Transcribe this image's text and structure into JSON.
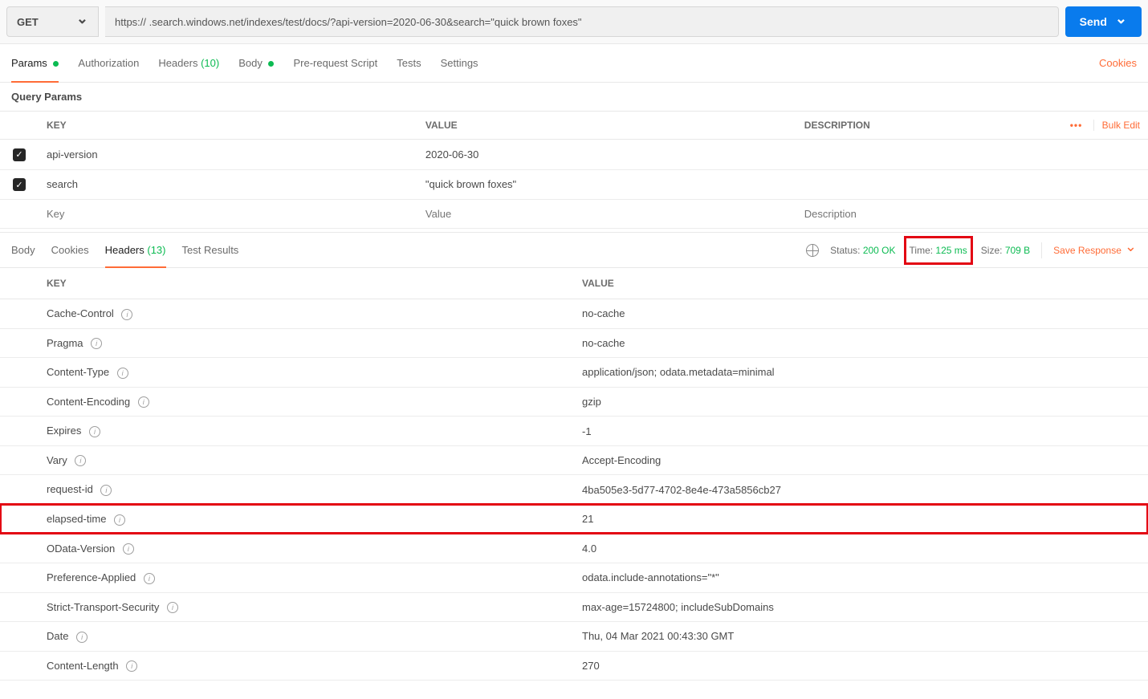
{
  "request": {
    "method": "GET",
    "url": "https://            .search.windows.net/indexes/test/docs/?api-version=2020-06-30&search=\"quick brown foxes\"",
    "send_label": "Send"
  },
  "req_tabs": {
    "params": "Params",
    "authorization": "Authorization",
    "headers": "Headers",
    "headers_count": "(10)",
    "body": "Body",
    "prerequest": "Pre-request Script",
    "tests": "Tests",
    "settings": "Settings",
    "cookies": "Cookies"
  },
  "query_params": {
    "title": "Query Params",
    "col_key": "KEY",
    "col_value": "VALUE",
    "col_desc": "DESCRIPTION",
    "bulk_edit": "Bulk Edit",
    "rows": [
      {
        "key": "api-version",
        "value": "2020-06-30"
      },
      {
        "key": "search",
        "value": "\"quick brown foxes\""
      }
    ],
    "ph_key": "Key",
    "ph_value": "Value",
    "ph_desc": "Description"
  },
  "resp_tabs": {
    "body": "Body",
    "cookies": "Cookies",
    "headers": "Headers",
    "headers_count": "(13)",
    "test_results": "Test Results"
  },
  "resp_meta": {
    "status_label": "Status:",
    "status_value": "200 OK",
    "time_label": "Time:",
    "time_value": "125 ms",
    "size_label": "Size:",
    "size_value": "709 B",
    "save_response": "Save Response"
  },
  "resp_headers": {
    "col_key": "KEY",
    "col_value": "VALUE",
    "rows": [
      {
        "key": "Cache-Control",
        "value": "no-cache"
      },
      {
        "key": "Pragma",
        "value": "no-cache"
      },
      {
        "key": "Content-Type",
        "value": "application/json; odata.metadata=minimal"
      },
      {
        "key": "Content-Encoding",
        "value": "gzip"
      },
      {
        "key": "Expires",
        "value": "-1"
      },
      {
        "key": "Vary",
        "value": "Accept-Encoding"
      },
      {
        "key": "request-id",
        "value": "4ba505e3-5d77-4702-8e4e-473a5856cb27"
      },
      {
        "key": "elapsed-time",
        "value": "21",
        "highlight": true
      },
      {
        "key": "OData-Version",
        "value": "4.0"
      },
      {
        "key": "Preference-Applied",
        "value": "odata.include-annotations=\"*\""
      },
      {
        "key": "Strict-Transport-Security",
        "value": "max-age=15724800; includeSubDomains"
      },
      {
        "key": "Date",
        "value": "Thu, 04 Mar 2021 00:43:30 GMT"
      },
      {
        "key": "Content-Length",
        "value": "270"
      }
    ]
  }
}
